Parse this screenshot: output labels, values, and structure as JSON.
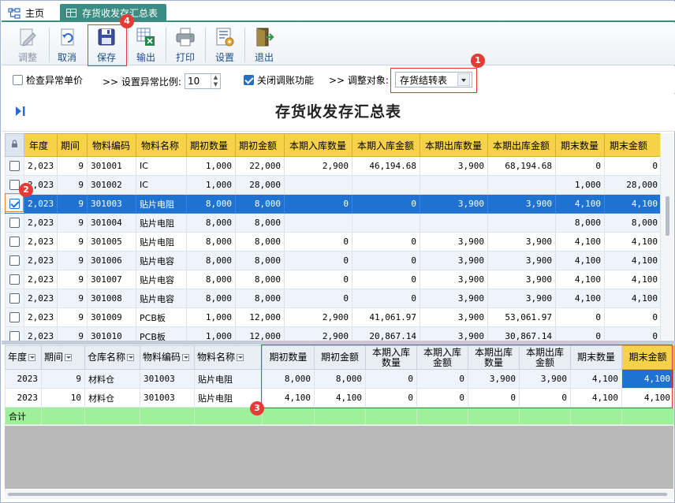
{
  "tabs": {
    "home": "主页",
    "active": "存货收发存汇总表"
  },
  "toolbar": {
    "adjust": "调整",
    "cancel": "取消",
    "save": "保存",
    "export": "输出",
    "print": "打印",
    "settings": "设置",
    "exit": "退出"
  },
  "options": {
    "check_abnormal_price": "检查异常单价",
    "set_ratio_label": ">> 设置异常比例:",
    "ratio_value": "10",
    "close_adjust": "关闭调账功能",
    "adjust_target_label": ">> 调整对象:",
    "adjust_target_value": "存货结转表"
  },
  "report_title": "存货收发存汇总表",
  "main_grid": {
    "headers": [
      "年度",
      "期间",
      "物料编码",
      "物料名称",
      "期初数量",
      "期初金额",
      "本期入库数量",
      "本期入库金额",
      "本期出库数量",
      "本期出库金额",
      "期末数量",
      "期末金额"
    ],
    "rows": [
      {
        "checked": false,
        "cells": [
          "2,023",
          "9",
          "301001",
          "IC",
          "1,000",
          "22,000",
          "2,900",
          "46,194.68",
          "3,900",
          "68,194.68",
          "0",
          "0"
        ]
      },
      {
        "checked": false,
        "cells": [
          "2,023",
          "9",
          "301002",
          "IC",
          "1,000",
          "28,000",
          "",
          "",
          "",
          "",
          "1,000",
          "28,000"
        ]
      },
      {
        "checked": true,
        "cells": [
          "2,023",
          "9",
          "301003",
          "贴片电阻",
          "8,000",
          "8,000",
          "0",
          "0",
          "3,900",
          "3,900",
          "4,100",
          "4,100"
        ]
      },
      {
        "checked": false,
        "cells": [
          "2,023",
          "9",
          "301004",
          "贴片电阻",
          "8,000",
          "8,000",
          "",
          "",
          "",
          "",
          "8,000",
          "8,000"
        ]
      },
      {
        "checked": false,
        "cells": [
          "2,023",
          "9",
          "301005",
          "贴片电阻",
          "8,000",
          "8,000",
          "0",
          "0",
          "3,900",
          "3,900",
          "4,100",
          "4,100"
        ]
      },
      {
        "checked": false,
        "cells": [
          "2,023",
          "9",
          "301006",
          "贴片电容",
          "8,000",
          "8,000",
          "0",
          "0",
          "3,900",
          "3,900",
          "4,100",
          "4,100"
        ]
      },
      {
        "checked": false,
        "cells": [
          "2,023",
          "9",
          "301007",
          "贴片电容",
          "8,000",
          "8,000",
          "0",
          "0",
          "3,900",
          "3,900",
          "4,100",
          "4,100"
        ]
      },
      {
        "checked": false,
        "cells": [
          "2,023",
          "9",
          "301008",
          "贴片电容",
          "8,000",
          "8,000",
          "0",
          "0",
          "3,900",
          "3,900",
          "4,100",
          "4,100"
        ]
      },
      {
        "checked": false,
        "cells": [
          "2,023",
          "9",
          "301009",
          "PCB板",
          "1,000",
          "12,000",
          "2,900",
          "41,061.97",
          "3,900",
          "53,061.97",
          "0",
          "0"
        ]
      },
      {
        "checked": false,
        "cells": [
          "2,023",
          "9",
          "301010",
          "PCB板",
          "1,000",
          "12,000",
          "2,900",
          "20,867.14",
          "3,900",
          "30,867.14",
          "0",
          "0"
        ]
      }
    ]
  },
  "detail_grid": {
    "headers": [
      "年度",
      "期间",
      "仓库名称",
      "物料编码",
      "物料名称",
      "期初数量",
      "期初金额",
      "本期入库数量",
      "本期入库金额",
      "本期出库数量",
      "本期出库金额",
      "期末数量",
      "期末金额"
    ],
    "header_lines": {
      "in_qty": [
        "本期入库",
        "数量"
      ],
      "in_amt": [
        "本期入库",
        "金额"
      ],
      "out_qty": [
        "本期出库",
        "数量"
      ],
      "out_amt": [
        "本期出库",
        "金额"
      ]
    },
    "rows": [
      [
        "2023",
        "9",
        "材料仓",
        "301003",
        "贴片电阻",
        "8,000",
        "8,000",
        "0",
        "0",
        "3,900",
        "3,900",
        "4,100",
        "4,100"
      ],
      [
        "2023",
        "10",
        "材料仓",
        "301003",
        "贴片电阻",
        "4,100",
        "4,100",
        "0",
        "0",
        "0",
        "0",
        "4,100",
        "4,100"
      ]
    ],
    "total_label": "合计"
  },
  "annotations": [
    "1",
    "2",
    "3",
    "4"
  ],
  "colors": {
    "accent": "#3a8d82",
    "header_yellow": "#f6d24a",
    "selected_row": "#1d72d2",
    "total_row": "#9ef09a",
    "annotation_red": "#e43b35"
  }
}
